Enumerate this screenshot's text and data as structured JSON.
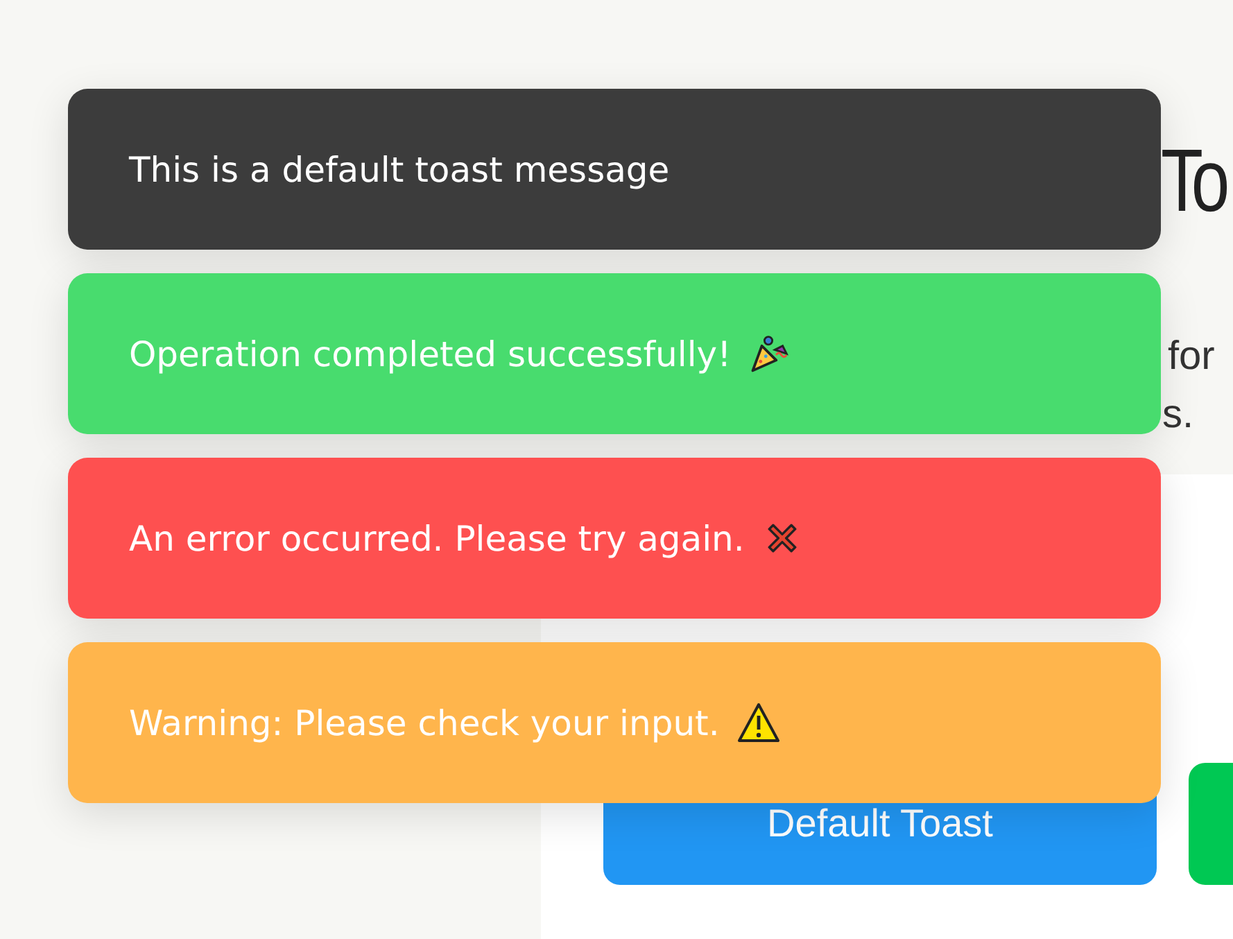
{
  "page": {
    "heading": "To",
    "paragraph_fragments": [
      "for",
      "s."
    ]
  },
  "card": {
    "buttons": [
      {
        "kind": "default",
        "label": "Default Toast"
      },
      {
        "kind": "success"
      }
    ]
  },
  "toasts": [
    {
      "kind": "default",
      "message": "This is a default toast message"
    },
    {
      "kind": "success",
      "message": "Operation completed successfully!"
    },
    {
      "kind": "error",
      "message": "An error occurred. Please try again."
    },
    {
      "kind": "warning",
      "message": "Warning: Please check your input."
    }
  ]
}
